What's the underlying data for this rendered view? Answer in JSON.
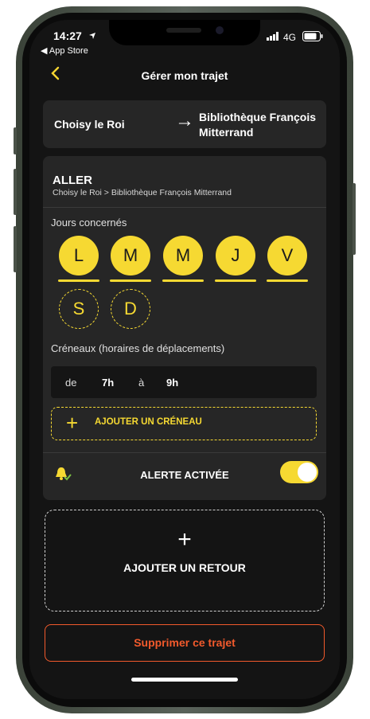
{
  "status_bar": {
    "time": "14:27",
    "network": "4G",
    "back_app": "◀ App Store"
  },
  "header": {
    "title": "Gérer mon trajet",
    "back_icon": "chevron-left-icon"
  },
  "route": {
    "from": "Choisy le Roi",
    "to": "Bibliothèque François Mitterrand",
    "arrow": "→"
  },
  "trip": {
    "direction_title": "ALLER",
    "direction_subtitle": "Choisy le Roi > Bibliothèque François Mitterrand",
    "days_label": "Jours concernés",
    "days": [
      {
        "letter": "L",
        "selected": true
      },
      {
        "letter": "M",
        "selected": true
      },
      {
        "letter": "M",
        "selected": true
      },
      {
        "letter": "J",
        "selected": true
      },
      {
        "letter": "V",
        "selected": true
      },
      {
        "letter": "S",
        "selected": false
      },
      {
        "letter": "D",
        "selected": false
      }
    ],
    "slots_label": "Créneaux (horaires de déplacements)",
    "slot": {
      "from_label": "de",
      "from_value": "7h",
      "to_label": "à",
      "to_value": "9h"
    },
    "add_slot_label": "AJOUTER UN CRÉNEAU",
    "alert_label": "ALERTE ACTIVÉE",
    "alert_enabled": true
  },
  "add_return_label": "AJOUTER UN RETOUR",
  "delete_label": "Supprimer ce trajet",
  "colors": {
    "accent": "#f6d932",
    "danger": "#f25a2c",
    "background": "#141414",
    "card": "#262626"
  }
}
